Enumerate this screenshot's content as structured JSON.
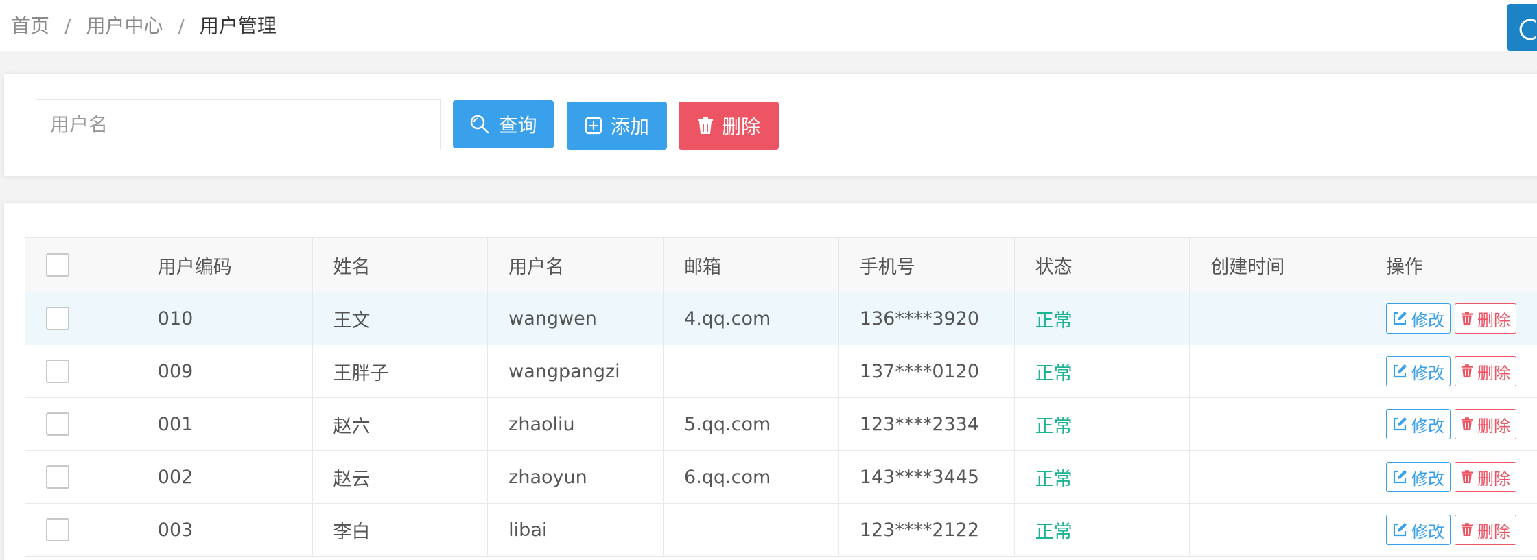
{
  "breadcrumb": {
    "items": [
      "首页",
      "用户中心",
      "用户管理"
    ],
    "separator": "/"
  },
  "search": {
    "placeholder": "用户名",
    "value": "",
    "query_label": "查询",
    "add_label": "添加",
    "delete_label": "删除"
  },
  "table": {
    "columns": [
      "用户编码",
      "姓名",
      "用户名",
      "邮箱",
      "手机号",
      "状态",
      "创建时间",
      "操作"
    ],
    "edit_label": "修改",
    "delete_label": "删除",
    "rows": [
      {
        "code": "010",
        "name": "王文",
        "username": "wangwen",
        "email": "4.qq.com",
        "phone": "136****3920",
        "status": "正常",
        "created": ""
      },
      {
        "code": "009",
        "name": "王胖子",
        "username": "wangpangzi",
        "email": "",
        "phone": "137****0120",
        "status": "正常",
        "created": ""
      },
      {
        "code": "001",
        "name": "赵六",
        "username": "zhaoliu",
        "email": "5.qq.com",
        "phone": "123****2334",
        "status": "正常",
        "created": ""
      },
      {
        "code": "002",
        "name": "赵云",
        "username": "zhaoyun",
        "email": "6.qq.com",
        "phone": "143****3445",
        "status": "正常",
        "created": ""
      },
      {
        "code": "003",
        "name": "李白",
        "username": "libai",
        "email": "",
        "phone": "123****2122",
        "status": "正常",
        "created": ""
      }
    ]
  },
  "colors": {
    "primary": "#39a0ec",
    "danger": "#ed5565",
    "success": "#1ab394",
    "row_highlight": "#eef7fc"
  },
  "icons": {
    "refresh": "refresh-icon",
    "query": "search-icon",
    "add": "plus-square-icon",
    "delete": "trash-icon",
    "edit": "edit-icon"
  }
}
